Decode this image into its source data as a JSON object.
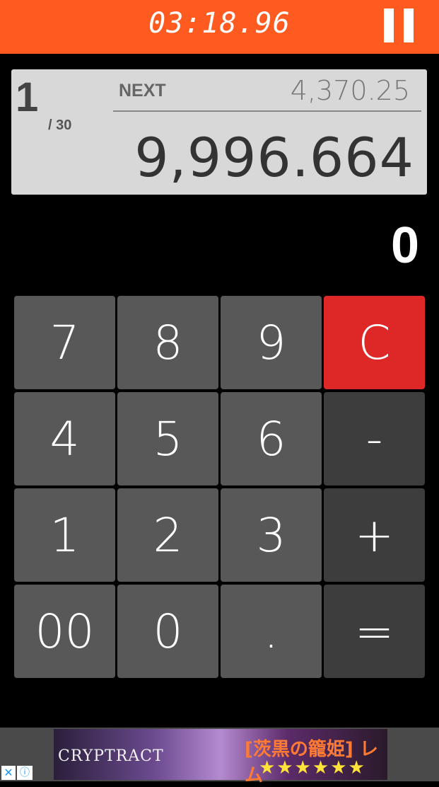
{
  "header": {
    "timer": "03:18.96",
    "pause_icon": "pause-icon",
    "bg_color": "#ff5a1f"
  },
  "question": {
    "number": "1",
    "total": "/ 30",
    "next_label": "NEXT",
    "next_value": "4,370.25",
    "target_value": "9,996.664"
  },
  "display": {
    "value": "0"
  },
  "keypad": {
    "k7": "7",
    "k8": "8",
    "k9": "9",
    "clear": "C",
    "k4": "4",
    "k5": "5",
    "k6": "6",
    "minus": "-",
    "k1": "1",
    "k2": "2",
    "k3": "3",
    "plus": "+",
    "k00": "00",
    "k0": "0",
    "dot": ".",
    "equals": "=",
    "clear_color": "#de2727"
  },
  "ad": {
    "brand": "CRYPTRACT",
    "title": "[茨黒の籠姫] レム",
    "stars": "★★★★★★",
    "close_icon": "close-icon",
    "info_icon": "info-icon"
  }
}
